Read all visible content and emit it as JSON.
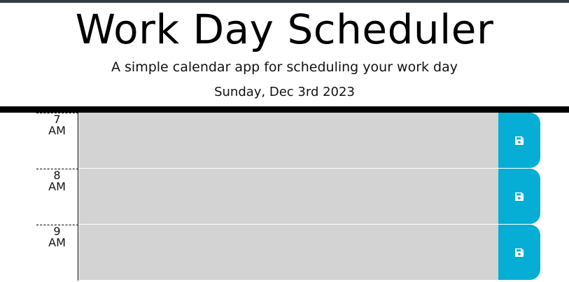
{
  "header": {
    "title": "Work Day Scheduler",
    "subtitle": "A simple calendar app for scheduling your work day",
    "current_day": "Sunday, Dec 3rd 2023"
  },
  "colors": {
    "past": "#d3d3d3",
    "save_button": "#06aed5",
    "top_bar": "#343a40"
  },
  "time_blocks": [
    {
      "hour": "7",
      "period": "AM",
      "text": "",
      "save_icon": "save-icon"
    },
    {
      "hour": "8",
      "period": "AM",
      "text": "",
      "save_icon": "save-icon"
    },
    {
      "hour": "9",
      "period": "AM",
      "text": "",
      "save_icon": "save-icon"
    }
  ]
}
